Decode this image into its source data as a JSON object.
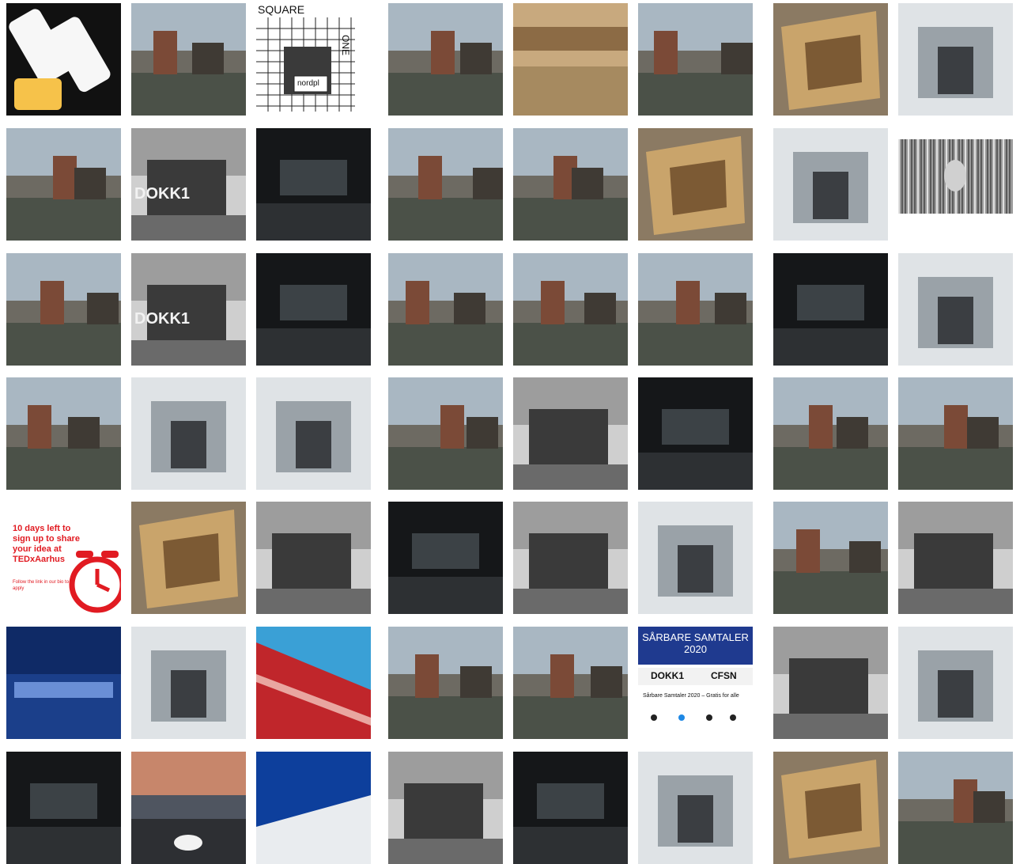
{
  "tiles": [
    {
      "id": "app-mockup",
      "style": "ui",
      "overlay": "",
      "caption": ""
    },
    {
      "id": "harbour-portrait",
      "style": "photo",
      "overlay": "",
      "caption": ""
    },
    {
      "id": "square-one",
      "style": "whitegrid",
      "overlay": "SQUARE",
      "overlay2": "ONE",
      "overlay3": "nordpl",
      "caption": ""
    },
    {
      "id": "crowd",
      "style": "photo",
      "overlay": "",
      "caption": ""
    },
    {
      "id": "vintage-harbour",
      "style": "sepia",
      "overlay": "",
      "caption": ""
    },
    {
      "id": "playground-sculpture",
      "style": "photo",
      "overlay": "",
      "caption": ""
    },
    {
      "id": "plywood-box",
      "style": "wood",
      "overlay": "",
      "caption": ""
    },
    {
      "id": "robot-toys",
      "style": "light",
      "overlay": "",
      "caption": ""
    },
    {
      "id": "bench-statue-1",
      "style": "photo",
      "overlay": "",
      "caption": ""
    },
    {
      "id": "dokk1-bw-1",
      "style": "bw",
      "overlay": "DOKK1",
      "caption": ""
    },
    {
      "id": "dark-hall-1",
      "style": "dark",
      "overlay": "",
      "caption": ""
    },
    {
      "id": "harbour-view-1",
      "style": "photo",
      "overlay": "",
      "caption": ""
    },
    {
      "id": "slide-sculpture",
      "style": "photo",
      "overlay": "",
      "caption": ""
    },
    {
      "id": "wooden-stairs",
      "style": "wood",
      "overlay": "",
      "caption": ""
    },
    {
      "id": "hooded-woman",
      "style": "light",
      "overlay": "",
      "caption": ""
    },
    {
      "id": "barcode-face",
      "style": "bars",
      "overlay": "",
      "caption": ""
    },
    {
      "id": "bench-statue-2",
      "style": "photo",
      "overlay": "",
      "caption": ""
    },
    {
      "id": "dokk1-bw-2",
      "style": "bw",
      "overlay": "DOKK1",
      "caption": ""
    },
    {
      "id": "dark-hall-2",
      "style": "dark",
      "overlay": "",
      "caption": ""
    },
    {
      "id": "eagle-sculpture",
      "style": "photo",
      "overlay": "",
      "caption": ""
    },
    {
      "id": "dokk1-exterior",
      "style": "photo",
      "overlay": "",
      "caption": ""
    },
    {
      "id": "parade",
      "style": "photo",
      "overlay": "",
      "caption": ""
    },
    {
      "id": "tram",
      "style": "dark",
      "overlay": "",
      "caption": ""
    },
    {
      "id": "tugboat",
      "style": "light",
      "overlay": "",
      "caption": ""
    },
    {
      "id": "shoreline",
      "style": "photo",
      "overlay": "",
      "caption": ""
    },
    {
      "id": "wedding",
      "style": "light",
      "overlay": "",
      "caption": ""
    },
    {
      "id": "bird-installation",
      "style": "light",
      "overlay": "",
      "caption": ""
    },
    {
      "id": "window-chairs",
      "style": "photo",
      "overlay": "",
      "caption": ""
    },
    {
      "id": "racecourse-1",
      "style": "bw",
      "overlay": "",
      "caption": ""
    },
    {
      "id": "ornate-ceiling",
      "style": "dark",
      "overlay": "",
      "caption": ""
    },
    {
      "id": "camo-wall",
      "style": "photo",
      "overlay": "",
      "caption": ""
    },
    {
      "id": "chess-game",
      "style": "photo",
      "overlay": "",
      "caption": ""
    },
    {
      "id": "tedx-poster",
      "style": "poster",
      "overlay": "10 days left to sign up to share your idea at TEDxAarhus",
      "overlay2": "Follow the link in our bio to apply",
      "caption": ""
    },
    {
      "id": "atrium",
      "style": "wood",
      "overlay": "",
      "caption": ""
    },
    {
      "id": "grey-street",
      "style": "bw",
      "overlay": "",
      "caption": ""
    },
    {
      "id": "night-stage",
      "style": "dark",
      "overlay": "",
      "caption": ""
    },
    {
      "id": "racecourse-2",
      "style": "bw",
      "overlay": "",
      "caption": ""
    },
    {
      "id": "dokk1-hazy",
      "style": "light",
      "overlay": "",
      "caption": ""
    },
    {
      "id": "wine-sculpture",
      "style": "photo",
      "overlay": "",
      "caption": ""
    },
    {
      "id": "guitar-bw-1",
      "style": "bw",
      "overlay": "",
      "caption": ""
    },
    {
      "id": "city-night",
      "style": "night",
      "overlay": "",
      "caption": ""
    },
    {
      "id": "dokk1-roof",
      "style": "light",
      "overlay": "",
      "caption": ""
    },
    {
      "id": "red-facade",
      "style": "red",
      "overlay": "",
      "caption": ""
    },
    {
      "id": "harbour-view-2",
      "style": "photo",
      "overlay": "",
      "caption": ""
    },
    {
      "id": "selfie",
      "style": "photo",
      "overlay": "",
      "caption": ""
    },
    {
      "id": "event-card",
      "style": "card",
      "overlay": "SÅRBARE SAMTALER 2020",
      "overlay2": "DOKK1",
      "overlay3": "CFSN",
      "caption": "Sårbare Samtaler 2020 – Gratis for alle"
    },
    {
      "id": "guitar-bw-2",
      "style": "bw",
      "overlay": "",
      "caption": ""
    },
    {
      "id": "balcony-fog",
      "style": "light",
      "overlay": "",
      "caption": ""
    },
    {
      "id": "dormer-roof",
      "style": "dark",
      "overlay": "",
      "caption": ""
    },
    {
      "id": "sunset-dokk1",
      "style": "sunset",
      "overlay": "",
      "caption": ""
    },
    {
      "id": "blue-sky-roof",
      "style": "sky",
      "overlay": "",
      "caption": ""
    },
    {
      "id": "toddler",
      "style": "bw",
      "overlay": "",
      "caption": ""
    },
    {
      "id": "library-neon",
      "style": "dark",
      "overlay": "",
      "caption": ""
    },
    {
      "id": "bikes-pile",
      "style": "light",
      "overlay": "",
      "caption": ""
    },
    {
      "id": "child-deck",
      "style": "wood",
      "overlay": "",
      "caption": ""
    },
    {
      "id": "book-table",
      "style": "photo",
      "overlay": "",
      "caption": ""
    }
  ]
}
